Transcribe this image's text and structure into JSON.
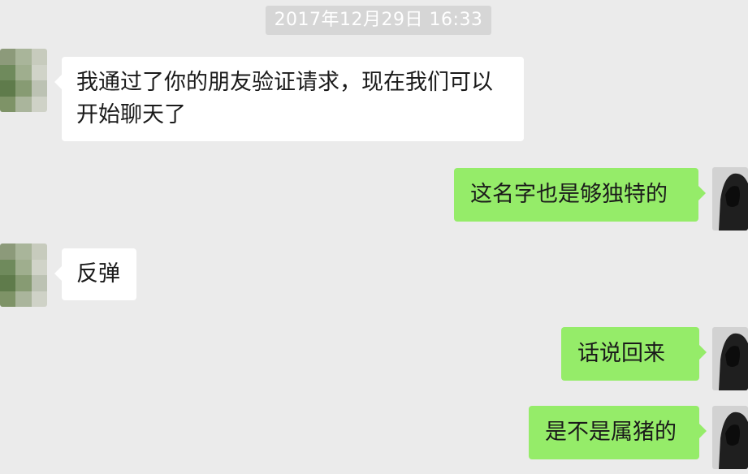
{
  "chat": {
    "timestamp": "2017年12月29日 16:33",
    "messages": [
      {
        "side": "incoming",
        "text": "我通过了你的朋友验证请求，现在我们可以开始聊天了",
        "line1": "我通过了你的朋友验证请求，现在我们可以",
        "line2": "开始聊天了"
      },
      {
        "side": "outgoing",
        "text": "这名字也是够独特的"
      },
      {
        "side": "incoming",
        "text": "反弹"
      },
      {
        "side": "outgoing",
        "text": "话说回来"
      },
      {
        "side": "outgoing",
        "text": "是不是属猪的"
      }
    ]
  },
  "colors": {
    "background": "#ebebeb",
    "outgoing_bubble": "#95ec69",
    "incoming_bubble": "#ffffff",
    "timestamp_pill": "#d6d6d6"
  },
  "icons": {
    "contact_avatar": "pixelated-avatar-icon",
    "self_avatar": "hooded-figure-avatar-icon"
  }
}
